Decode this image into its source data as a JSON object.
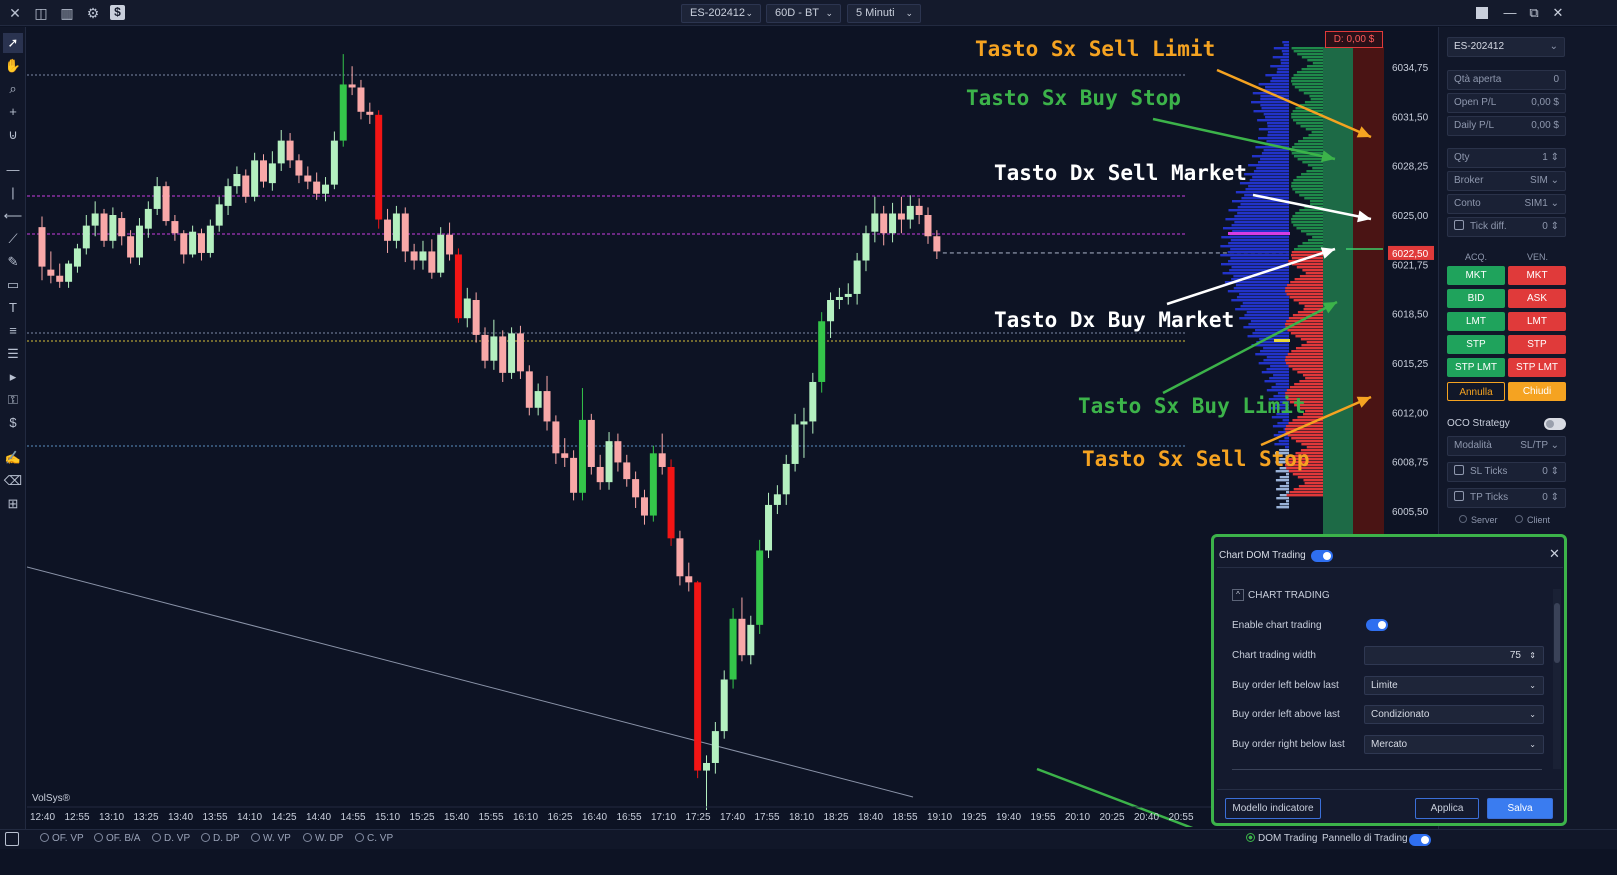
{
  "toolbar": {
    "symbol": "ES-202412",
    "timeframe_range": "60D - BT",
    "interval": "5 Minuti"
  },
  "price_scale": {
    "labels": [
      "6034,75",
      "6031,50",
      "6028,25",
      "6025,00",
      "6021,75",
      "6018,50",
      "6015,25",
      "6012,00",
      "6008,75",
      "6005,50"
    ],
    "last_price": "6022,50",
    "pnl_badge": "D: 0,00 $"
  },
  "time_axis": {
    "labels": [
      "12:40",
      "12:55",
      "13:10",
      "13:25",
      "13:40",
      "13:55",
      "14:10",
      "14:25",
      "14:40",
      "14:55",
      "15:10",
      "15:25",
      "15:40",
      "15:55",
      "16:10",
      "16:25",
      "16:40",
      "16:55",
      "17:10",
      "17:25",
      "17:40",
      "17:55",
      "18:10",
      "18:25",
      "18:40",
      "18:55",
      "19:10",
      "19:25",
      "19:40",
      "19:55",
      "20:10",
      "20:25",
      "20:40",
      "20:55"
    ]
  },
  "watermark": "VolSys®",
  "annotations": {
    "sx_sell_limit": "Tasto Sx Sell Limit",
    "sx_buy_stop": "Tasto Sx Buy Stop",
    "dx_sell_market": "Tasto Dx Sell Market",
    "dx_buy_market": "Tasto Dx Buy Market",
    "sx_buy_limit": "Tasto Sx Buy Limit",
    "sx_sell_stop": "Tasto Sx Sell Stop"
  },
  "colors": {
    "bull": "#b4f0c0",
    "bull_strong": "#34c54a",
    "bear": "#f9a8a8",
    "bear_strong": "#f21515",
    "orange": "#f5a321",
    "green_annot": "#3cb34a",
    "accent": "#2f6ff0"
  },
  "bottom_bar": {
    "indicators": [
      "OF. VP",
      "OF. B/A",
      "D. VP",
      "D. DP",
      "W. VP",
      "W. DP",
      "C. VP"
    ],
    "dom_trading": "DOM Trading",
    "trading_panel": "Pannello di Trading"
  },
  "right_panel": {
    "symbol": "ES-202412",
    "open_qty_label": "Qtà aperta",
    "open_qty_value": "0",
    "open_pl_label": "Open P/L",
    "open_pl_value": "0,00 $",
    "daily_pl_label": "Daily P/L",
    "daily_pl_value": "0,00 $",
    "qty_label": "Qty",
    "qty_value": "1",
    "broker_label": "Broker",
    "broker_value": "SIM",
    "account_label": "Conto",
    "account_value": "SIM1",
    "tick_diff_label": "Tick diff.",
    "tick_diff_value": "0",
    "buy_header": "ACQ.",
    "sell_header": "VEN.",
    "buy_buttons": [
      "MKT",
      "BID",
      "LMT",
      "STP",
      "STP LMT"
    ],
    "sell_buttons": [
      "MKT",
      "ASK",
      "LMT",
      "STP",
      "STP LMT"
    ],
    "cancel": "Annulla",
    "close": "Chiudi",
    "oco_label": "OCO Strategy",
    "mode_label": "Modalità",
    "mode_value": "SL/TP",
    "sl_label": "SL Ticks",
    "sl_value": "0",
    "tp_label": "TP Ticks",
    "tp_value": "0",
    "server": "Server",
    "client": "Client"
  },
  "dialog": {
    "title": "Chart DOM Trading",
    "section": "CHART TRADING",
    "enable_label": "Enable chart trading",
    "width_label": "Chart trading width",
    "width_value": "75",
    "buy_left_below_label": "Buy order left below last",
    "buy_left_below_value": "Limite",
    "buy_left_above_label": "Buy order left above last",
    "buy_left_above_value": "Condizionato",
    "buy_right_below_label": "Buy order right below last",
    "buy_right_below_value": "Mercato",
    "template_btn": "Modello indicatore",
    "apply_btn": "Applica",
    "save_btn": "Salva"
  }
}
